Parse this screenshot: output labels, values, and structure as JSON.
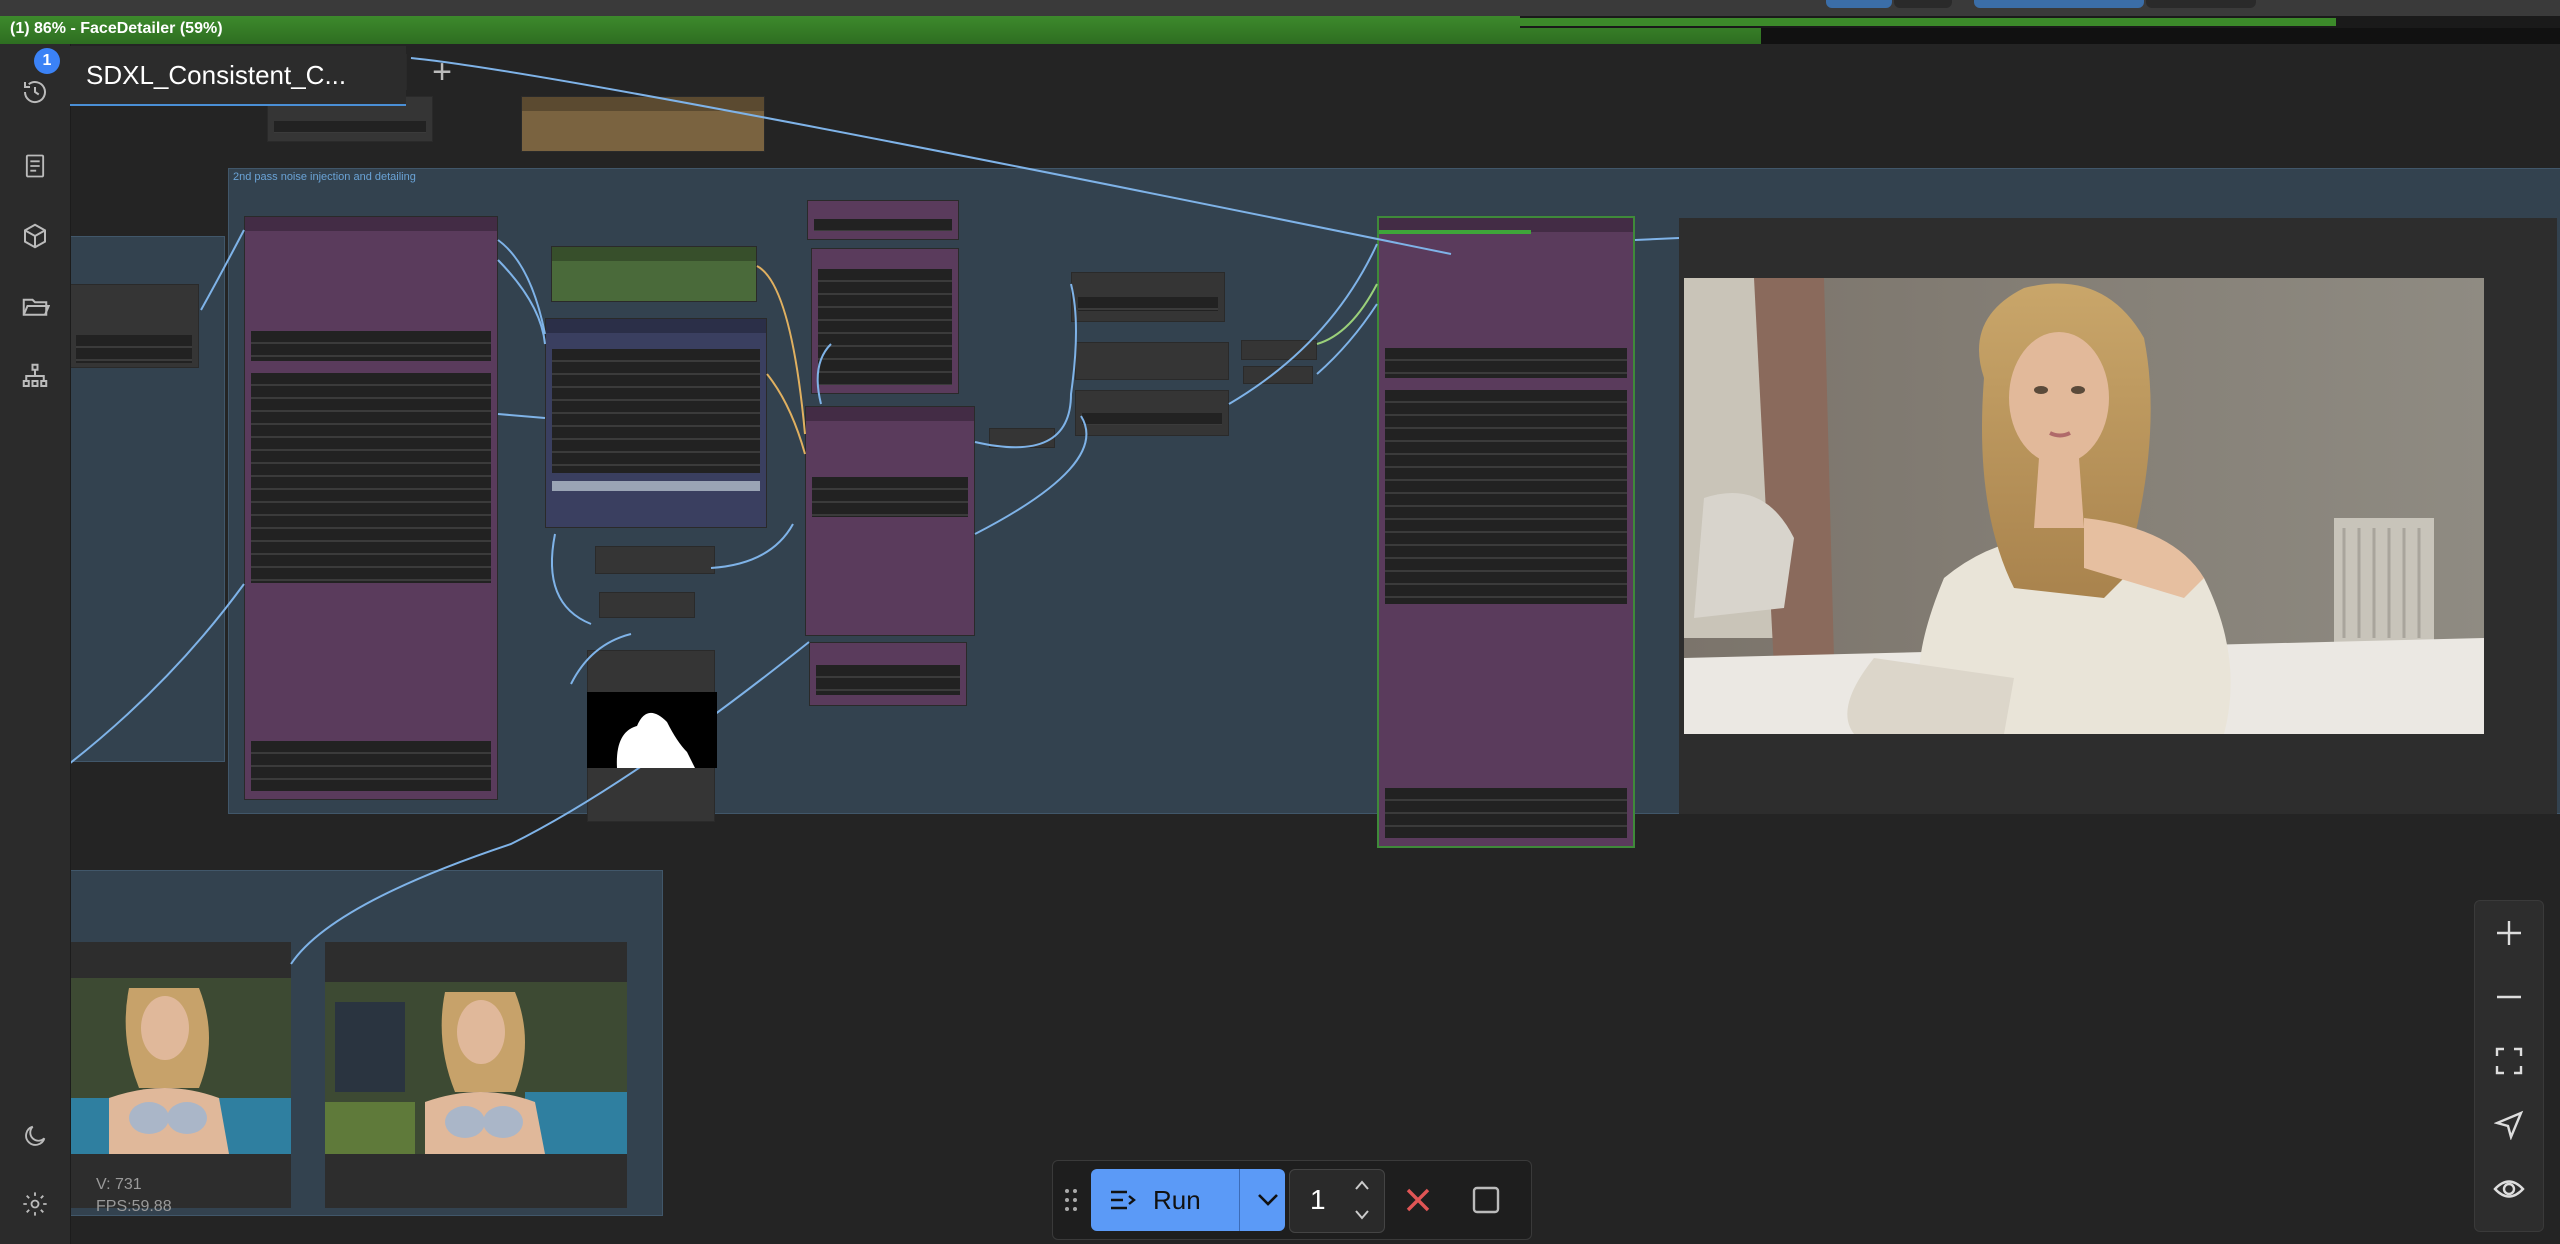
{
  "progress": {
    "label": "(1) 86% - FaceDetailer (59%)",
    "overall_fraction": 0.86,
    "node_fraction": 0.59
  },
  "workflow": {
    "tab_title": "SDXL_Consistent_C...",
    "queue_badge": "1",
    "add_tab_label": "+"
  },
  "group": {
    "title": "2nd pass noise injection and detailing"
  },
  "stats": {
    "vertices": "V: 731",
    "fps": "FPS:59.88"
  },
  "runbar": {
    "run_label": "Run",
    "batch_count": "1"
  },
  "sidebar": {
    "items": [
      {
        "icon": "queue-history-icon"
      },
      {
        "icon": "node-library-icon"
      },
      {
        "icon": "model-library-icon"
      },
      {
        "icon": "workflows-folder-icon"
      },
      {
        "icon": "templates-tree-icon"
      },
      {
        "icon": "theme-moon-icon"
      },
      {
        "icon": "settings-gear-icon"
      }
    ]
  },
  "zoom_controls": {
    "icons": [
      "zoom-in-icon",
      "zoom-out-icon",
      "fit-view-icon",
      "locate-icon",
      "toggle-links-icon"
    ]
  },
  "colors": {
    "accent": "#5b9af7",
    "progress": "#3d8a2c",
    "group_bg": "#33424f",
    "node_purple": "#5a3b5c",
    "cancel_red": "#e05555"
  }
}
